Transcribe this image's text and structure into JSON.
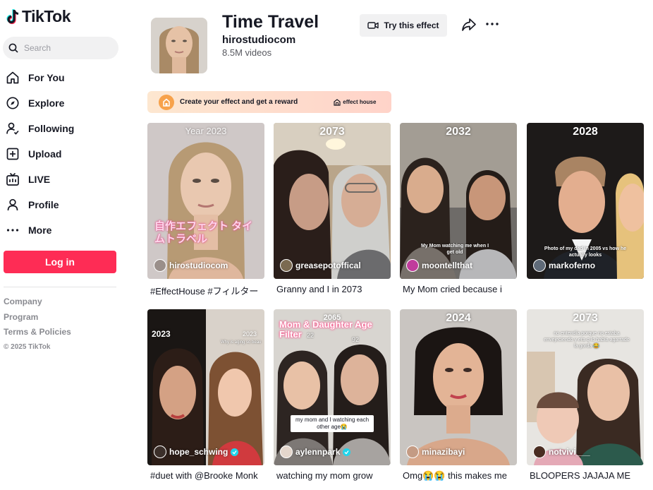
{
  "brand": {
    "logo_text": "TikTok"
  },
  "search": {
    "placeholder": "Search"
  },
  "nav": [
    {
      "label": "For You",
      "icon": "home-icon"
    },
    {
      "label": "Explore",
      "icon": "compass-icon"
    },
    {
      "label": "Following",
      "icon": "following-icon"
    },
    {
      "label": "Upload",
      "icon": "upload-icon"
    },
    {
      "label": "LIVE",
      "icon": "live-icon"
    },
    {
      "label": "Profile",
      "icon": "profile-icon"
    },
    {
      "label": "More",
      "icon": "more-dots-icon"
    }
  ],
  "login_label": "Log in",
  "footer": {
    "links": [
      "Company",
      "Program",
      "Terms & Policies"
    ],
    "copyright": "© 2025 TikTok"
  },
  "effect": {
    "title": "Time Travel",
    "author": "hirostudiocom",
    "video_count": "8.5M videos",
    "try_label": "Try this effect"
  },
  "banner": {
    "text": "Create your effect and get a reward",
    "brand": "effect house"
  },
  "videos": [
    {
      "year": "Year 2023",
      "username": "hirostudiocom",
      "caption": "#EffectHouse #フィルター",
      "overlay": "自作エフェクト タイムトラベル",
      "verified": false
    },
    {
      "year": "2073",
      "username": "greasepotoffical",
      "caption": "Granny and I in 2073",
      "verified": false
    },
    {
      "year": "2032",
      "username": "moontellthat",
      "caption": "My Mom cried because i",
      "overlay": "My Mom watching me when I get old",
      "verified": false
    },
    {
      "year": "2028",
      "username": "markoferno",
      "caption": "",
      "overlay": "Photo of my dad in 2005 vs how he actually looks",
      "verified": false
    },
    {
      "year": "2023",
      "year2": "2023",
      "username": "hope_schwing",
      "caption": "#duet with @Brooke Monk",
      "overlay": "Why is aging so beau",
      "verified": true
    },
    {
      "year": "2065",
      "username": "aylennpark",
      "caption": "watching my mom grow",
      "overlay_title": "Mom & Daughter Age Filter",
      "age_left": "22",
      "age_right": "92",
      "overlay": "my mom and I watching each other age😭",
      "verified": true
    },
    {
      "year": "2024",
      "username": "minazibayi",
      "caption": "Omg😭😭 this makes me",
      "verified": false
    },
    {
      "year": "2073",
      "username": "notvivi___",
      "caption": "BLOOPERS JAJAJA ME",
      "overlay": "no entendía porque no estaba envejeciendo y era q lo había agarrado la gorda 😂",
      "verified": false
    }
  ],
  "colors": {
    "accent": "#fe2c55",
    "verified": "#20d5ec",
    "banner_start": "#fde7d0",
    "banner_end": "#ffd3c9"
  }
}
